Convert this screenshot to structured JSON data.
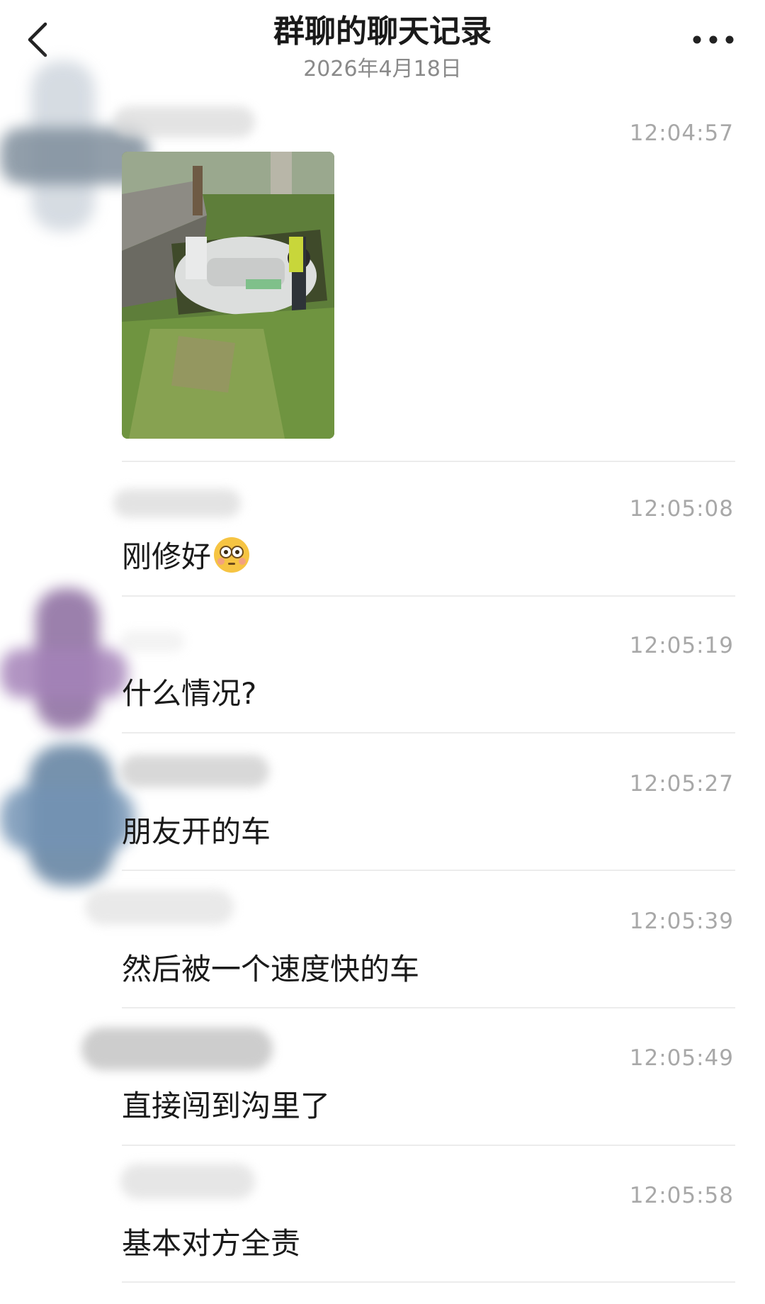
{
  "header": {
    "title": "群聊的聊天记录",
    "date": "2026年4月18日"
  },
  "messages": [
    {
      "time": "12:04:57",
      "type": "image"
    },
    {
      "time": "12:05:08",
      "text": "刚修好"
    },
    {
      "time": "12:05:19",
      "text": "什么情况?"
    },
    {
      "time": "12:05:27",
      "text": "朋友开的车"
    },
    {
      "time": "12:05:39",
      "text": "然后被一个速度快的车"
    },
    {
      "time": "12:05:49",
      "text": "直接闯到沟里了"
    },
    {
      "time": "12:05:58",
      "text": "基本对方全责"
    }
  ],
  "colors": {
    "title": "#1a1a1a",
    "timestamp": "#a8a8a8",
    "divider": "#ececec",
    "background": "#ffffff"
  },
  "icons": {
    "back": "chevron-left-icon",
    "more": "more-dots-icon",
    "emoji": "flushed-face-emoji"
  }
}
